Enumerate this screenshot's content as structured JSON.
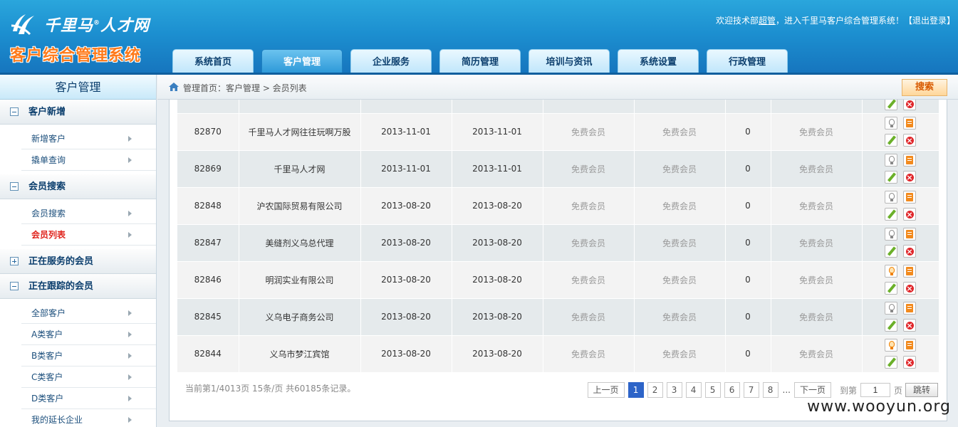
{
  "header": {
    "logo_text": "千里马",
    "logo_text2": "人才网",
    "system_name": "客户综合管理系统",
    "welcome_prefix": "欢迎技术部",
    "welcome_user": "超管",
    "welcome_suffix": "，进入千里马客户综合管理系统！",
    "logout": "【退出登录】"
  },
  "nav": {
    "tabs": [
      {
        "label": "系统首页"
      },
      {
        "label": "客户管理"
      },
      {
        "label": "企业服务"
      },
      {
        "label": "简历管理"
      },
      {
        "label": "培训与资讯"
      },
      {
        "label": "系统设置"
      },
      {
        "label": "行政管理"
      }
    ]
  },
  "sidebar": {
    "title": "客户管理",
    "groups": [
      {
        "label": "客户新增",
        "items": [
          "新增客户",
          "撬单查询"
        ]
      },
      {
        "label": "会员搜索",
        "items": [
          "会员搜索",
          "会员列表"
        ]
      },
      {
        "label": "正在服务的会员"
      },
      {
        "label": "正在跟踪的会员",
        "items": [
          "全部客户",
          "A类客户",
          "B类客户",
          "C类客户",
          "D类客户",
          "我的延长企业"
        ]
      }
    ]
  },
  "breadcrumb": {
    "text": "管理首页：客户管理 > 会员列表",
    "search_label": "搜索"
  },
  "table": {
    "rows": [
      [
        "82870",
        "千里马人才网往往玩啊万股",
        "2013-11-01",
        "2013-11-01",
        "免费会员",
        "免费会员",
        "0",
        "免费会员"
      ],
      [
        "82869",
        "千里马人才网",
        "2013-11-01",
        "2013-11-01",
        "免费会员",
        "免费会员",
        "0",
        "免费会员"
      ],
      [
        "82848",
        "沪农国际贸易有限公司",
        "2013-08-20",
        "2013-08-20",
        "免费会员",
        "免费会员",
        "0",
        "免费会员"
      ],
      [
        "82847",
        "美缝剂义乌总代理",
        "2013-08-20",
        "2013-08-20",
        "免费会员",
        "免费会员",
        "0",
        "免费会员"
      ],
      [
        "82846",
        "明润实业有限公司",
        "2013-08-20",
        "2013-08-20",
        "免费会员",
        "免费会员",
        "0",
        "免费会员"
      ],
      [
        "82845",
        "义乌电子商务公司",
        "2013-08-20",
        "2013-08-20",
        "免费会员",
        "免费会员",
        "0",
        "免费会员"
      ],
      [
        "82844",
        "义乌市梦江宾馆",
        "2013-08-20",
        "2013-08-20",
        "免费会员",
        "免费会员",
        "0",
        "免费会员"
      ]
    ],
    "bulb_on_rows": [
      4,
      6
    ]
  },
  "pagination": {
    "summary": "当前第1/4013页 15条/页 共60185条记录。",
    "prev": "上一页",
    "pages": [
      "1",
      "2",
      "3",
      "4",
      "5",
      "6",
      "7",
      "8"
    ],
    "current": "1",
    "ellipsis": "...",
    "next": "下一页",
    "goto_prefix": "到第",
    "goto_value": "1",
    "goto_suffix": "页",
    "goto_button": "跳转"
  },
  "watermark": "www.wooyun.org"
}
